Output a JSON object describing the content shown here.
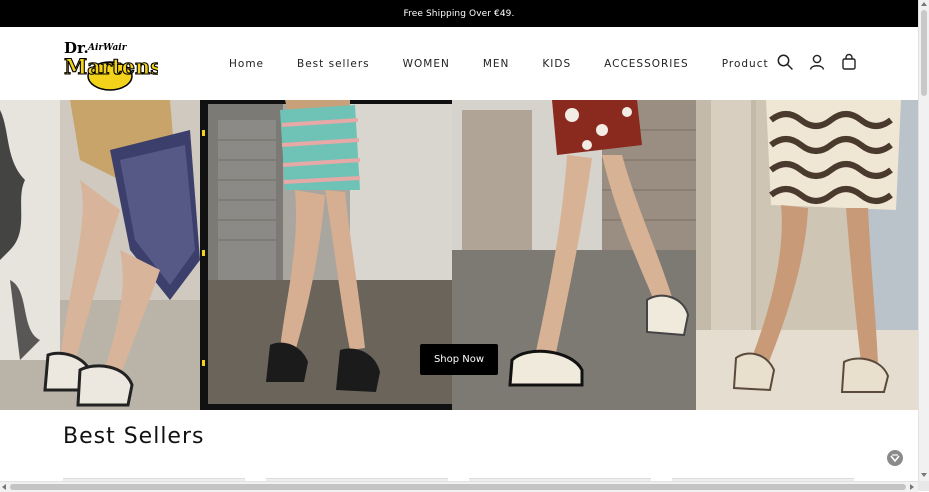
{
  "announcement": {
    "text": "Free Shipping Over €49."
  },
  "brand": {
    "logo_top": "Dr.",
    "logo_script": "AirWair",
    "logo_main": "Martens"
  },
  "nav": {
    "items": [
      {
        "label": "Home"
      },
      {
        "label": "Best sellers"
      },
      {
        "label": "WOMEN"
      },
      {
        "label": "MEN"
      },
      {
        "label": "KIDS"
      },
      {
        "label": "ACCESSORIES"
      },
      {
        "label": "Product"
      }
    ]
  },
  "header_icons": [
    "search-icon",
    "account-icon",
    "cart-icon"
  ],
  "hero": {
    "cta_label": "Shop Now"
  },
  "best_sellers": {
    "title": "Best Sellers"
  },
  "colors": {
    "announcement_bg": "#000000",
    "cta_bg": "#000000",
    "logo_yellow": "#f2d21b"
  }
}
